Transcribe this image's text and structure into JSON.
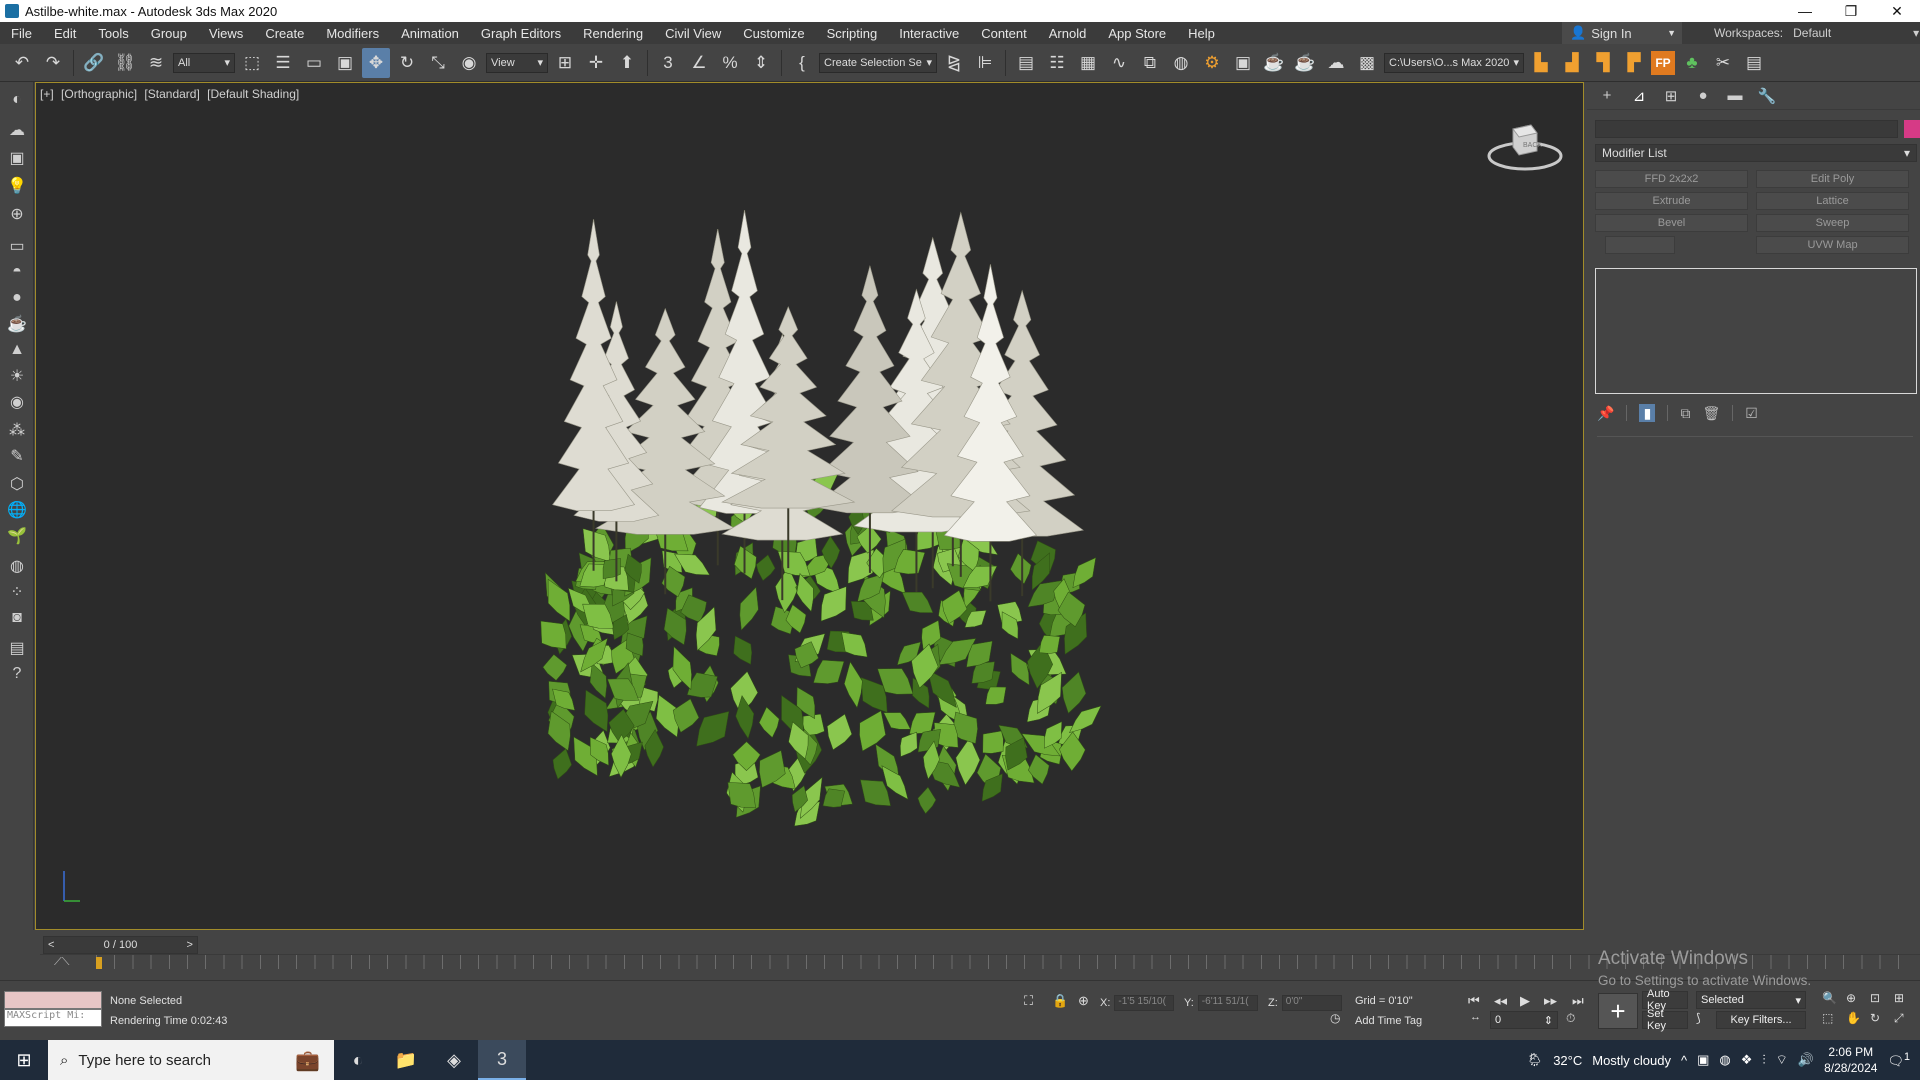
{
  "window": {
    "title": "Astilbe-white.max - Autodesk 3ds Max 2020",
    "controls": [
      "—",
      "❐",
      "✕"
    ]
  },
  "menu": [
    "File",
    "Edit",
    "Tools",
    "Group",
    "Views",
    "Create",
    "Modifiers",
    "Animation",
    "Graph Editors",
    "Rendering",
    "Civil View",
    "Customize",
    "Scripting",
    "Interactive",
    "Content",
    "Arnold",
    "App Store",
    "Help"
  ],
  "account": {
    "sign_in": "Sign In",
    "workspaces_label": "Workspaces:",
    "workspace_value": "Default"
  },
  "toolbar": {
    "selection_filter": "All",
    "ref_coord": "View",
    "named_selection": "Create Selection Se",
    "project_path": "C:\\Users\\O...s Max 2020",
    "fp_label": "FP"
  },
  "viewport": {
    "label_plus": "[+]",
    "label_view": "[Orthographic]",
    "label_standard": "[Standard]",
    "label_shading": "[Default Shading]",
    "viewcube_face": "BACK"
  },
  "command_panel": {
    "modifier_list": "Modifier List",
    "modifier_buttons": [
      "FFD 2x2x2",
      "Edit Poly",
      "Extrude",
      "Lattice",
      "Bevel",
      "Sweep",
      "",
      "UVW Map"
    ],
    "object_color": "#d63a86"
  },
  "timeline": {
    "frame_display": "0 / 100",
    "prev": "<",
    "next": ">"
  },
  "status": {
    "maxscript_placeholder": "MAXScript Mi:",
    "selection": "None Selected",
    "rendering_time": "Rendering Time  0:02:43",
    "x_label": "X:",
    "x_value": "-1'5 15/10(",
    "y_label": "Y:",
    "y_value": "-6'11 51/1(",
    "z_label": "Z:",
    "z_value": "0'0\"",
    "grid": "Grid = 0'10\"",
    "add_time_tag": "Add Time Tag",
    "auto_key": "Auto Key",
    "key_mode": "Selected",
    "set_key": "Set Key",
    "key_filters": "Key Filters...",
    "frame_field": "0"
  },
  "watermark": {
    "line1": "Activate Windows",
    "line2": "Go to Settings to activate Windows."
  },
  "taskbar": {
    "search_placeholder": "Type here to search",
    "weather_temp": "32°C",
    "weather_desc": "Mostly cloudy",
    "time": "2:06 PM",
    "date": "8/28/2024",
    "notif_count": "1"
  }
}
